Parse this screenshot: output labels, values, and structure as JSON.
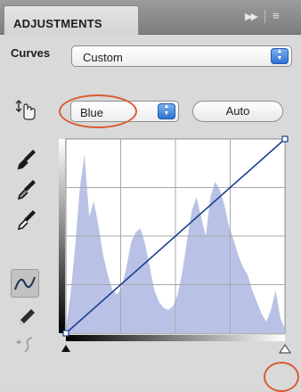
{
  "panel": {
    "tab_title": "ADJUSTMENTS",
    "close_glyph": "×",
    "arrows_glyph": "▶▶",
    "menu_glyph": "≡"
  },
  "curves": {
    "label": "Curves",
    "preset_value": "Custom"
  },
  "channel": {
    "value": "Blue",
    "auto_label": "Auto"
  },
  "tools": [
    "on-image-adjust-icon",
    "black-point-eyedropper-icon",
    "gray-point-eyedropper-icon",
    "white-point-eyedropper-icon",
    "curve-points-icon",
    "pencil-draw-icon",
    "smooth-curve-icon"
  ],
  "graph": {
    "grid_divisions": 4,
    "input_range": [
      0,
      255
    ],
    "output_range": [
      0,
      255
    ],
    "curve_points": [
      [
        0,
        0
      ],
      [
        255,
        255
      ]
    ],
    "histogram_color": "#b9c2e6",
    "curve_color": "#1d3f8f",
    "histogram": [
      2,
      20,
      45,
      75,
      92,
      60,
      68,
      55,
      40,
      30,
      22,
      20,
      24,
      34,
      47,
      52,
      54,
      46,
      34,
      22,
      16,
      13,
      12,
      14,
      20,
      32,
      48,
      63,
      70,
      60,
      50,
      70,
      78,
      74,
      66,
      55,
      48,
      40,
      34,
      30,
      22,
      16,
      10,
      6,
      12,
      22,
      8,
      2
    ]
  },
  "colors": {
    "accent_blue": "#3a7be0",
    "annotation_red": "#d95b33"
  }
}
